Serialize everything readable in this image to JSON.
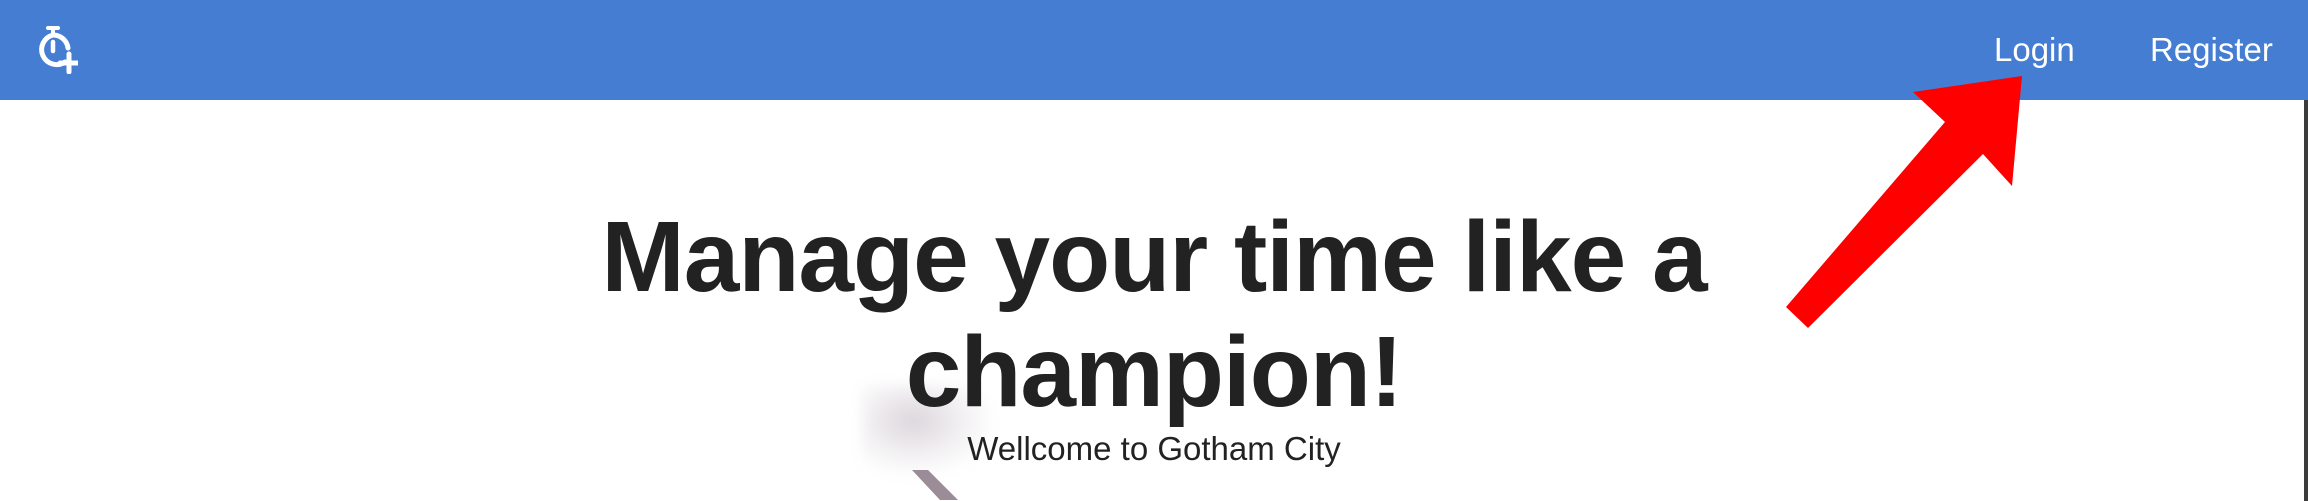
{
  "header": {
    "logo_icon": "stopwatch-plus-icon",
    "links": {
      "login": "Login",
      "register": "Register"
    },
    "background_color": "#447dd2"
  },
  "hero": {
    "title_line1": "Manage your time like a",
    "title_line2": "champion!",
    "subtitle": "Wellcome to Gotham City"
  },
  "annotation": {
    "arrow_color": "#ff0000",
    "arrow_icon": "red-arrow-pointing-to-login"
  }
}
